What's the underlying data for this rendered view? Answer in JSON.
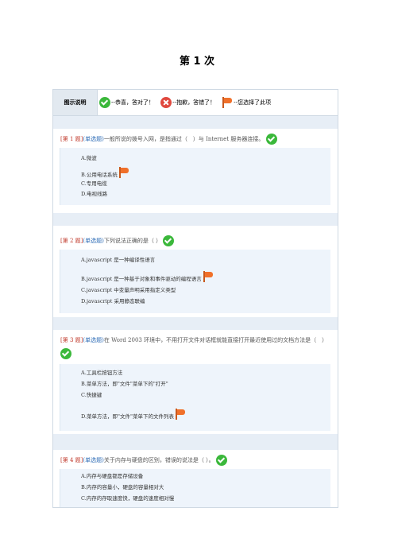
{
  "page_title": "第 1 次",
  "legend": {
    "header": "图示说明",
    "items": [
      {
        "icon": "check-icon",
        "text": "--恭喜，答对了！"
      },
      {
        "icon": "cross-icon",
        "text": "--抱歉，答错了！"
      },
      {
        "icon": "flag-icon",
        "text": "--您选择了此项"
      }
    ]
  },
  "questions": [
    {
      "number": "[第 1 题]",
      "type": "(单选题)",
      "text": "一般所说的拨号入网，是指通过（　）与 Internet 服务器连接。",
      "result_icon": "check-icon",
      "options": [
        {
          "text": "A.微波",
          "selected": false
        },
        {
          "text": "B.公用电话系统",
          "selected": true
        },
        {
          "text": "C.专用电缆",
          "selected": false
        },
        {
          "text": "D.电视线路",
          "selected": false
        }
      ]
    },
    {
      "number": "[第 2 题]",
      "type": "(单选题)",
      "text": "下列说法正确的是（ ）",
      "result_icon": "check-icon",
      "options": [
        {
          "text": "A.javascript 是一种编译性语言",
          "selected": false
        },
        {
          "text": "B.javascript 是一种基于对象和事件驱动的编程语言",
          "selected": true
        },
        {
          "text": "C.javascript 中变量声明采用指定义类型",
          "selected": false
        },
        {
          "text": "D.javascript 采用静态联编",
          "selected": false
        }
      ]
    },
    {
      "number": "[第 3 题]",
      "type": "(单选题)",
      "text": "在 Word 2003 环境中，不用打开文件对话框就能直接打开最近使用过的文档方法是（　）",
      "result_icon": "check-icon",
      "options": [
        {
          "text": "A.工具栏按钮方法",
          "selected": false
        },
        {
          "text": "B.菜单方法，即\"文件\"菜单下的\"打开\"",
          "selected": false
        },
        {
          "text": "C.快捷键",
          "selected": false
        },
        {
          "text": "D.菜单方法，即\"文件\"菜单下的文件列表",
          "selected": true
        }
      ]
    },
    {
      "number": "[第 4 题]",
      "type": "(单选题)",
      "text": "关于内存与硬盘的区别，错误的说法是（ ）。",
      "result_icon": "check-icon",
      "options": [
        {
          "text": "A.内存与硬盘都是存储设备",
          "selected": false
        },
        {
          "text": "B.内存的容量小，硬盘的容量相对大",
          "selected": false
        },
        {
          "text": "C.内存的存取速度快，硬盘的速度相对慢",
          "selected": false
        }
      ]
    }
  ]
}
